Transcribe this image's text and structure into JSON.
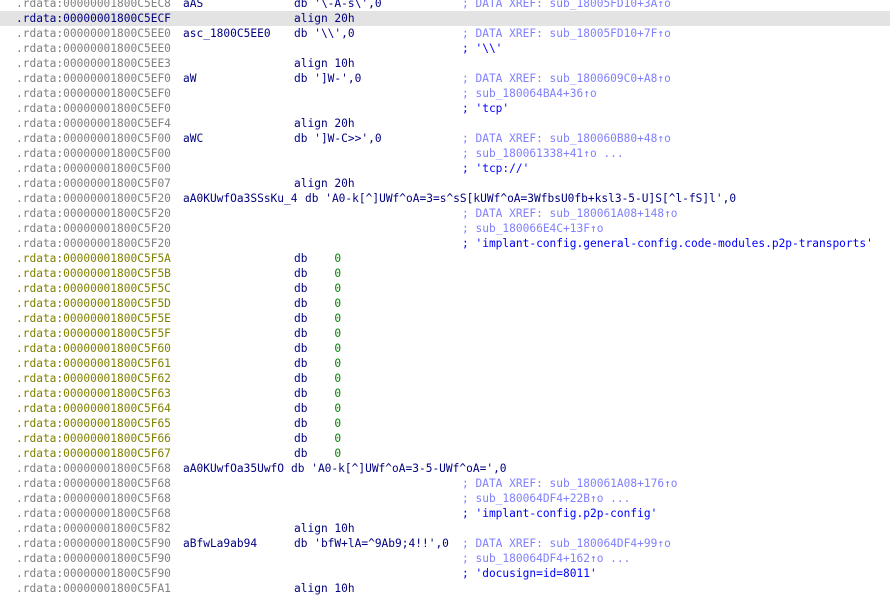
{
  "listing": {
    "rows": [
      {
        "addr": ".rdata:00000001800C5EC8",
        "label": "aAS",
        "instr": "db '\\-A-s\\',0",
        "comment": "; DATA XREF: sub_18005FD10+3A↑o",
        "comment_kind": "xref"
      },
      {
        "addr": ".rdata:00000001800C5ECF",
        "label": "",
        "instr": "align 20h",
        "comment": "",
        "comment_kind": "",
        "highlighted": true
      },
      {
        "addr": ".rdata:00000001800C5EE0",
        "label": "asc_1800C5EE0",
        "instr": "db '\\\\',0",
        "comment": "; DATA XREF: sub_18005FD10+7F↑o",
        "comment_kind": "xref"
      },
      {
        "addr": ".rdata:00000001800C5EE0",
        "label": "",
        "instr": "",
        "comment": "; '\\\\'",
        "comment_kind": "str"
      },
      {
        "addr": ".rdata:00000001800C5EE3",
        "label": "",
        "instr": "align 10h",
        "comment": "",
        "comment_kind": ""
      },
      {
        "addr": ".rdata:00000001800C5EF0",
        "label": "aW",
        "instr": "db ']W-',0",
        "comment": "; DATA XREF: sub_1800609C0+A8↑o",
        "comment_kind": "xref"
      },
      {
        "addr": ".rdata:00000001800C5EF0",
        "label": "",
        "instr": "",
        "comment": "; sub_180064BA4+36↑o",
        "comment_kind": "xref"
      },
      {
        "addr": ".rdata:00000001800C5EF0",
        "label": "",
        "instr": "",
        "comment": "; 'tcp'",
        "comment_kind": "str"
      },
      {
        "addr": ".rdata:00000001800C5EF4",
        "label": "",
        "instr": "align 20h",
        "comment": "",
        "comment_kind": ""
      },
      {
        "addr": ".rdata:00000001800C5F00",
        "label": "aWC",
        "instr": "db ']W-C>>',0",
        "comment": "; DATA XREF: sub_180060B80+48↑o",
        "comment_kind": "xref"
      },
      {
        "addr": ".rdata:00000001800C5F00",
        "label": "",
        "instr": "",
        "comment": "; sub_180061338+41↑o ...",
        "comment_kind": "xref"
      },
      {
        "addr": ".rdata:00000001800C5F00",
        "label": "",
        "instr": "",
        "comment": "; 'tcp://'",
        "comment_kind": "str"
      },
      {
        "addr": ".rdata:00000001800C5F07",
        "label": "",
        "instr": "align 20h",
        "comment": "",
        "comment_kind": ""
      },
      {
        "addr": ".rdata:00000001800C5F20",
        "label": "aA0KUwfOa3SSsKu_4",
        "instr": "db 'A0-k[^]UWf^oA=3=s^sS[kUWf^oA=3WfbsU0fb+ksl3-5-U]S[^l-fS]l',0",
        "comment": "",
        "comment_kind": "",
        "long_label": true
      },
      {
        "addr": ".rdata:00000001800C5F20",
        "label": "",
        "instr": "",
        "comment": "; DATA XREF: sub_180061A08+148↑o",
        "comment_kind": "xref"
      },
      {
        "addr": ".rdata:00000001800C5F20",
        "label": "",
        "instr": "",
        "comment": "; sub_180066E4C+13F↑o",
        "comment_kind": "xref"
      },
      {
        "addr": ".rdata:00000001800C5F20",
        "label": "",
        "instr": "",
        "comment": "; 'implant-config.general-config.code-modules.p2p-transports'",
        "comment_kind": "str"
      },
      {
        "addr": ".rdata:00000001800C5F5A",
        "label": "",
        "instr": "db    0",
        "comment": "",
        "comment_kind": "",
        "undef": true
      },
      {
        "addr": ".rdata:00000001800C5F5B",
        "label": "",
        "instr": "db    0",
        "comment": "",
        "comment_kind": "",
        "undef": true
      },
      {
        "addr": ".rdata:00000001800C5F5C",
        "label": "",
        "instr": "db    0",
        "comment": "",
        "comment_kind": "",
        "undef": true
      },
      {
        "addr": ".rdata:00000001800C5F5D",
        "label": "",
        "instr": "db    0",
        "comment": "",
        "comment_kind": "",
        "undef": true
      },
      {
        "addr": ".rdata:00000001800C5F5E",
        "label": "",
        "instr": "db    0",
        "comment": "",
        "comment_kind": "",
        "undef": true
      },
      {
        "addr": ".rdata:00000001800C5F5F",
        "label": "",
        "instr": "db    0",
        "comment": "",
        "comment_kind": "",
        "undef": true
      },
      {
        "addr": ".rdata:00000001800C5F60",
        "label": "",
        "instr": "db    0",
        "comment": "",
        "comment_kind": "",
        "undef": true
      },
      {
        "addr": ".rdata:00000001800C5F61",
        "label": "",
        "instr": "db    0",
        "comment": "",
        "comment_kind": "",
        "undef": true
      },
      {
        "addr": ".rdata:00000001800C5F62",
        "label": "",
        "instr": "db    0",
        "comment": "",
        "comment_kind": "",
        "undef": true
      },
      {
        "addr": ".rdata:00000001800C5F63",
        "label": "",
        "instr": "db    0",
        "comment": "",
        "comment_kind": "",
        "undef": true
      },
      {
        "addr": ".rdata:00000001800C5F64",
        "label": "",
        "instr": "db    0",
        "comment": "",
        "comment_kind": "",
        "undef": true
      },
      {
        "addr": ".rdata:00000001800C5F65",
        "label": "",
        "instr": "db    0",
        "comment": "",
        "comment_kind": "",
        "undef": true
      },
      {
        "addr": ".rdata:00000001800C5F66",
        "label": "",
        "instr": "db    0",
        "comment": "",
        "comment_kind": "",
        "undef": true
      },
      {
        "addr": ".rdata:00000001800C5F67",
        "label": "",
        "instr": "db    0",
        "comment": "",
        "comment_kind": "",
        "undef": true
      },
      {
        "addr": ".rdata:00000001800C5F68",
        "label": "aA0KUwfOa35UwfO",
        "instr": "db 'A0-k[^]UWf^oA=3-5-UWf^oA=',0",
        "comment": "",
        "comment_kind": "",
        "long_label": true
      },
      {
        "addr": ".rdata:00000001800C5F68",
        "label": "",
        "instr": "",
        "comment": "; DATA XREF: sub_180061A08+176↑o",
        "comment_kind": "xref"
      },
      {
        "addr": ".rdata:00000001800C5F68",
        "label": "",
        "instr": "",
        "comment": "; sub_180064DF4+22B↑o ...",
        "comment_kind": "xref"
      },
      {
        "addr": ".rdata:00000001800C5F68",
        "label": "",
        "instr": "",
        "comment": "; 'implant-config.p2p-config'",
        "comment_kind": "str"
      },
      {
        "addr": ".rdata:00000001800C5F82",
        "label": "",
        "instr": "align 10h",
        "comment": "",
        "comment_kind": ""
      },
      {
        "addr": ".rdata:00000001800C5F90",
        "label": "aBfwLa9ab94",
        "instr": "db 'bfW+lA=^9Ab9;4!!',0",
        "comment": "; DATA XREF: sub_180064DF4+99↑o",
        "comment_kind": "xref"
      },
      {
        "addr": ".rdata:00000001800C5F90",
        "label": "",
        "instr": "",
        "comment": "; sub_180064DF4+162↑o ...",
        "comment_kind": "xref"
      },
      {
        "addr": ".rdata:00000001800C5F90",
        "label": "",
        "instr": "",
        "comment": "; 'docusign=id=8011'",
        "comment_kind": "str"
      },
      {
        "addr": ".rdata:00000001800C5FA1",
        "label": "",
        "instr": "align 10h",
        "comment": "",
        "comment_kind": ""
      }
    ]
  },
  "colors": {
    "address": "#808080",
    "address_undefined": "#808000",
    "text": "#000080",
    "number": "#008000",
    "comment": "#8080ff",
    "string_comment": "#0000ff",
    "highlight": "#e3e3e3"
  }
}
